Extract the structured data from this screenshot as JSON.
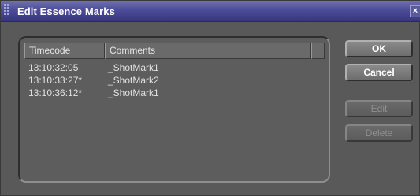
{
  "dialog": {
    "title": "Edit Essence Marks",
    "close_glyph": "×"
  },
  "table": {
    "columns": [
      "Timecode",
      "Comments"
    ],
    "rows": [
      {
        "timecode": "13:10:32:05",
        "comment": "_ShotMark1"
      },
      {
        "timecode": "13:10:33:27*",
        "comment": "_ShotMark2"
      },
      {
        "timecode": "13:10:36:12*",
        "comment": "_ShotMark1"
      }
    ]
  },
  "buttons": {
    "ok": "OK",
    "cancel": "Cancel",
    "edit": "Edit",
    "delete": "Delete"
  }
}
